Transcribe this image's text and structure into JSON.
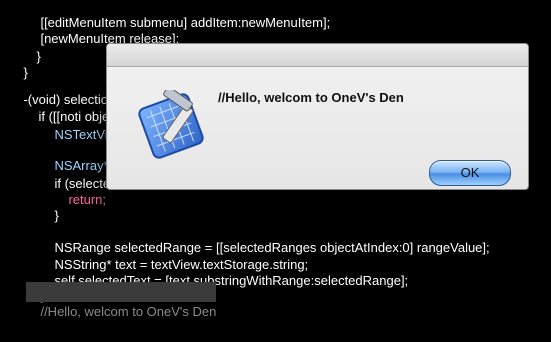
{
  "editor": {
    "lines": [
      {
        "parts": [
          "[[editMenuItem submenu] addItem:newMenuItem];"
        ]
      },
      {
        "parts": [
          "[newMenuItem release];"
        ]
      },
      {
        "parts": [
          "}"
        ]
      },
      {
        "parts": [
          "}"
        ]
      },
      {
        "parts": [
          "-(void) selection"
        ]
      },
      {
        "parts": [
          "if ([[noti object"
        ]
      },
      {
        "parts": [
          "NSTextView"
        ]
      },
      {
        "parts": [
          "NSArray* se"
        ]
      },
      {
        "parts": [
          "if (selected"
        ]
      },
      {
        "parts": [
          "return;"
        ]
      },
      {
        "parts": [
          "}"
        ]
      },
      {
        "parts": [
          "NSRange selectedRange = [[selectedRanges objectAtIndex:0] rangeValue];"
        ]
      },
      {
        "parts": [
          "NSString* text = textView.textStorage.string;"
        ]
      },
      {
        "parts": [
          "self.selectedText = [text substringWithRange:selectedRange];"
        ]
      },
      {
        "parts": [
          "}"
        ]
      },
      {
        "parts": [
          "//Hello, welcom to OneV's Den"
        ]
      }
    ]
  },
  "dialog": {
    "message": "//Hello, welcom to OneV's Den",
    "ok_label": "OK",
    "icon": "xcode-hammer-icon"
  }
}
